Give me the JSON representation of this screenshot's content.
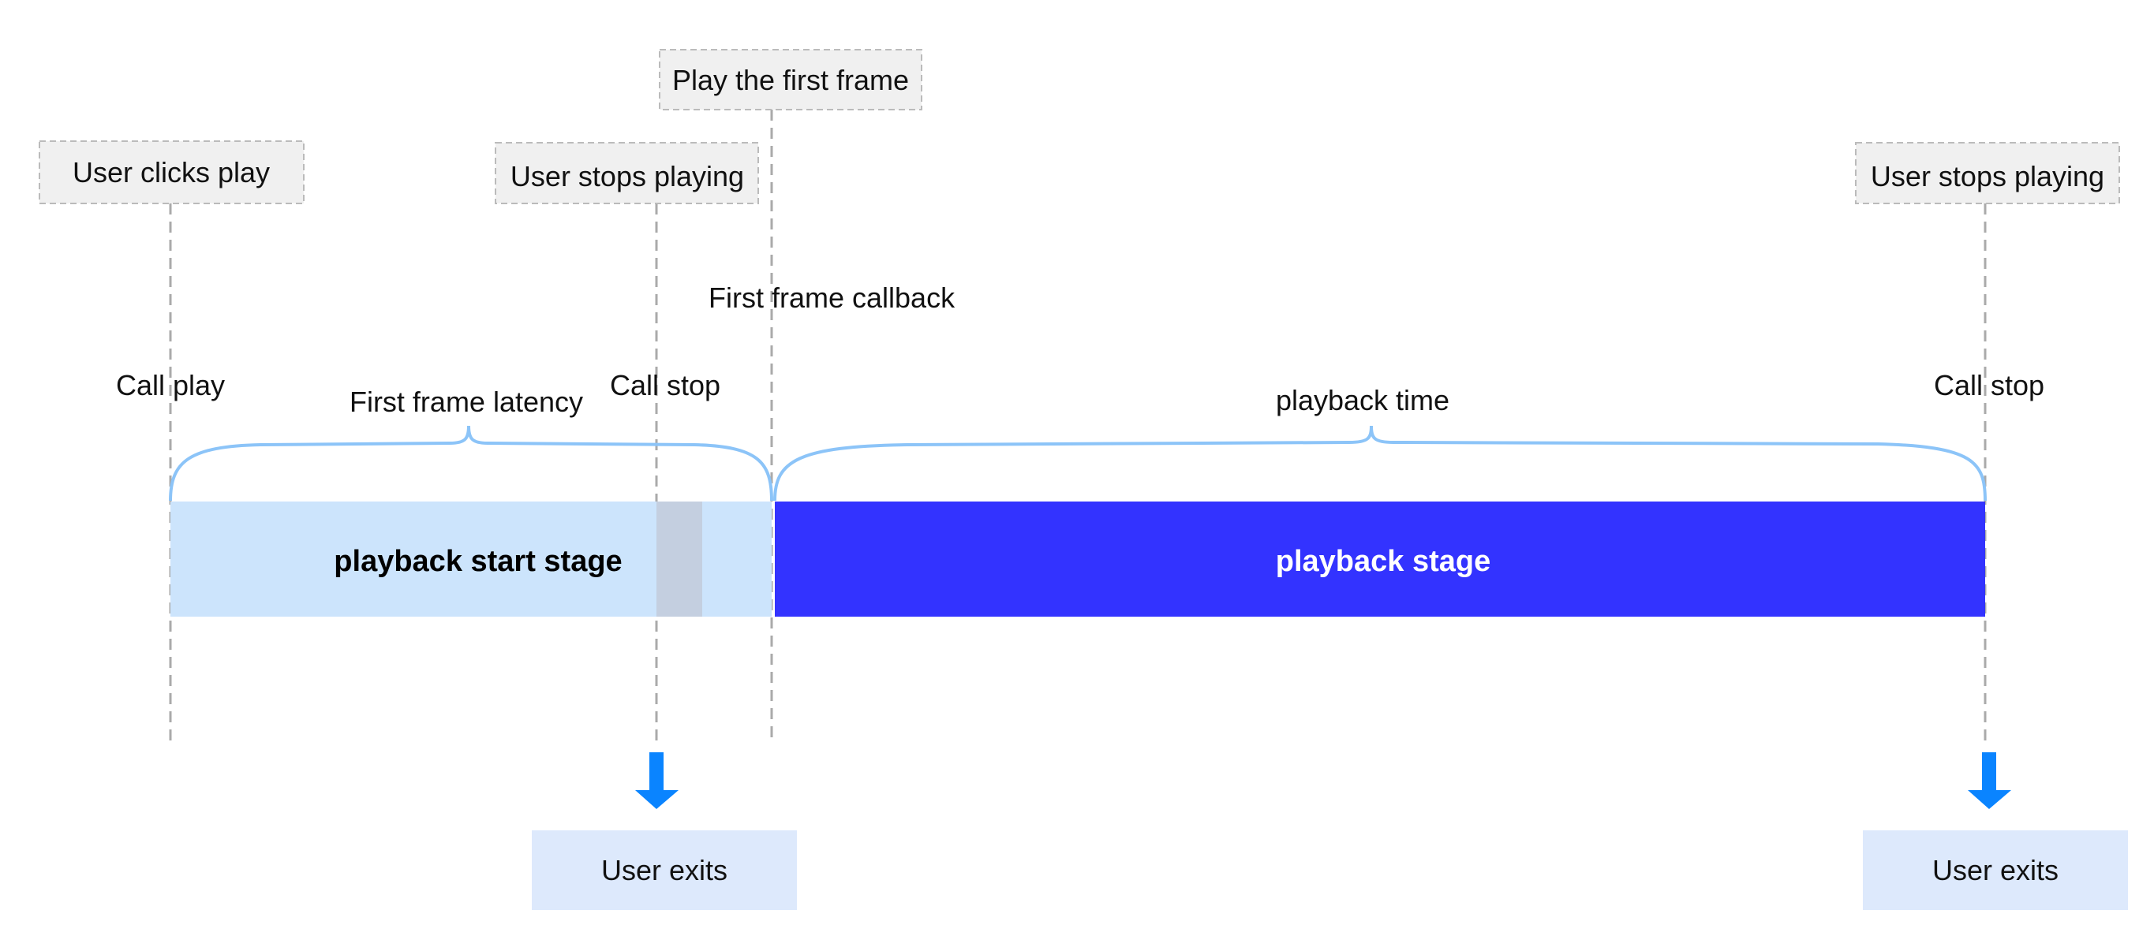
{
  "events": {
    "user_clicks_play": "User clicks play",
    "play_first_frame": "Play the first frame",
    "user_stops_playing_early": "User stops playing",
    "user_stops_playing_end": "User stops playing"
  },
  "labels": {
    "call_play": "Call play",
    "first_frame_latency": "First frame latency",
    "call_stop_early": "Call stop",
    "first_frame_callback": "First frame callback",
    "playback_time": "playback time",
    "call_stop_end": "Call stop"
  },
  "stages": {
    "start_stage": "playback start stage",
    "playback_stage": "playback stage"
  },
  "exits": {
    "early": "User exits",
    "end": "User exits"
  },
  "colors": {
    "start_stage": "#cce4fc",
    "stopped_segment": "#c4cfe0",
    "playback_stage": "#3333ff",
    "brace": "#8cc4f8",
    "arrow": "#0a84ff",
    "exit_box": "#dde9fc",
    "event_box": "#f0f0f0"
  }
}
